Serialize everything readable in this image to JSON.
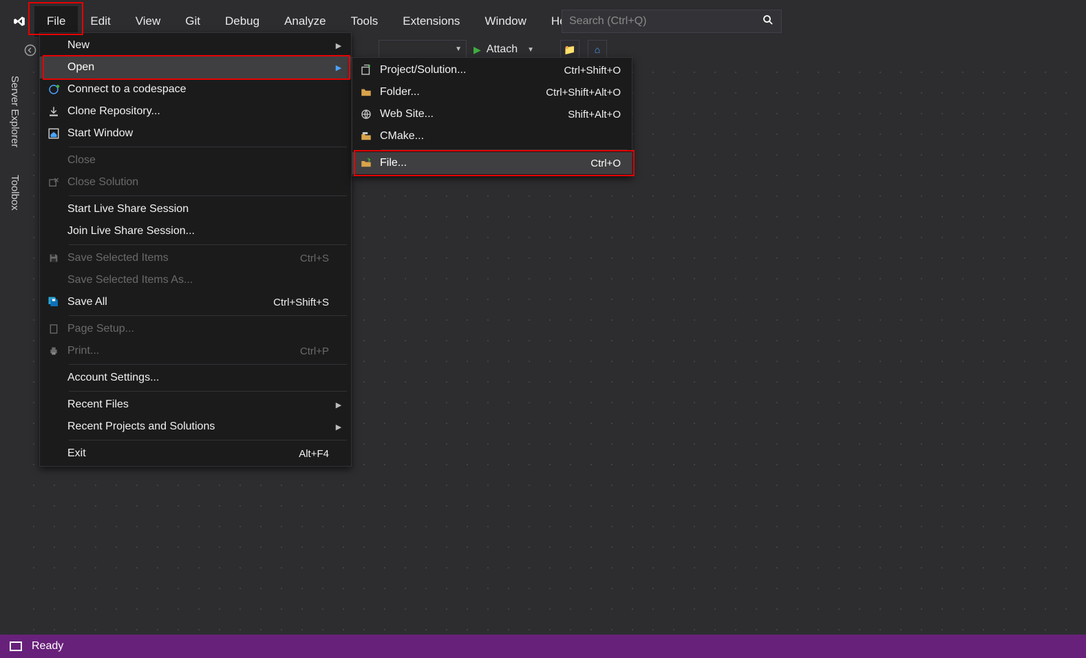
{
  "menu": {
    "items": [
      "File",
      "Edit",
      "View",
      "Git",
      "Debug",
      "Analyze",
      "Tools",
      "Extensions",
      "Window",
      "Help"
    ]
  },
  "search": {
    "placeholder": "Search (Ctrl+Q)"
  },
  "toolbar": {
    "attach": "Attach"
  },
  "side": {
    "server": "Server Explorer",
    "toolbox": "Toolbox"
  },
  "file_menu": [
    {
      "label": "New",
      "arrow": true
    },
    {
      "label": "Open",
      "arrow": true,
      "hover": true
    },
    {
      "label": "Connect to a codespace",
      "icon": "connect"
    },
    {
      "label": "Clone Repository...",
      "icon": "clone"
    },
    {
      "label": "Start Window",
      "icon": "home"
    },
    {
      "sep": true
    },
    {
      "label": "Close",
      "disabled": true
    },
    {
      "label": "Close Solution",
      "disabled": true,
      "icon": "close-solution"
    },
    {
      "sep": true
    },
    {
      "label": "Start Live Share Session"
    },
    {
      "label": "Join Live Share Session..."
    },
    {
      "sep": true
    },
    {
      "label": "Save Selected Items",
      "shortcut": "Ctrl+S",
      "icon": "save",
      "disabled": true
    },
    {
      "label": "Save Selected Items As...",
      "disabled": true
    },
    {
      "label": "Save All",
      "shortcut": "Ctrl+Shift+S",
      "icon": "saveall"
    },
    {
      "sep": true
    },
    {
      "label": "Page Setup...",
      "icon": "page",
      "disabled": true
    },
    {
      "label": "Print...",
      "shortcut": "Ctrl+P",
      "icon": "print",
      "disabled": true
    },
    {
      "sep": true
    },
    {
      "label": "Account Settings..."
    },
    {
      "sep": true
    },
    {
      "label": "Recent Files",
      "arrow": true
    },
    {
      "label": "Recent Projects and Solutions",
      "arrow": true
    },
    {
      "sep": true
    },
    {
      "label": "Exit",
      "shortcut": "Alt+F4"
    }
  ],
  "open_menu": [
    {
      "label": "Project/Solution...",
      "shortcut": "Ctrl+Shift+O",
      "icon": "project"
    },
    {
      "label": "Folder...",
      "shortcut": "Ctrl+Shift+Alt+O",
      "icon": "folder"
    },
    {
      "label": "Web Site...",
      "shortcut": "Shift+Alt+O",
      "icon": "web"
    },
    {
      "label": "CMake...",
      "icon": "cmake"
    },
    {
      "sep": true
    },
    {
      "label": "File...",
      "shortcut": "Ctrl+O",
      "icon": "file",
      "hover": true
    }
  ],
  "status": {
    "ready": "Ready"
  }
}
